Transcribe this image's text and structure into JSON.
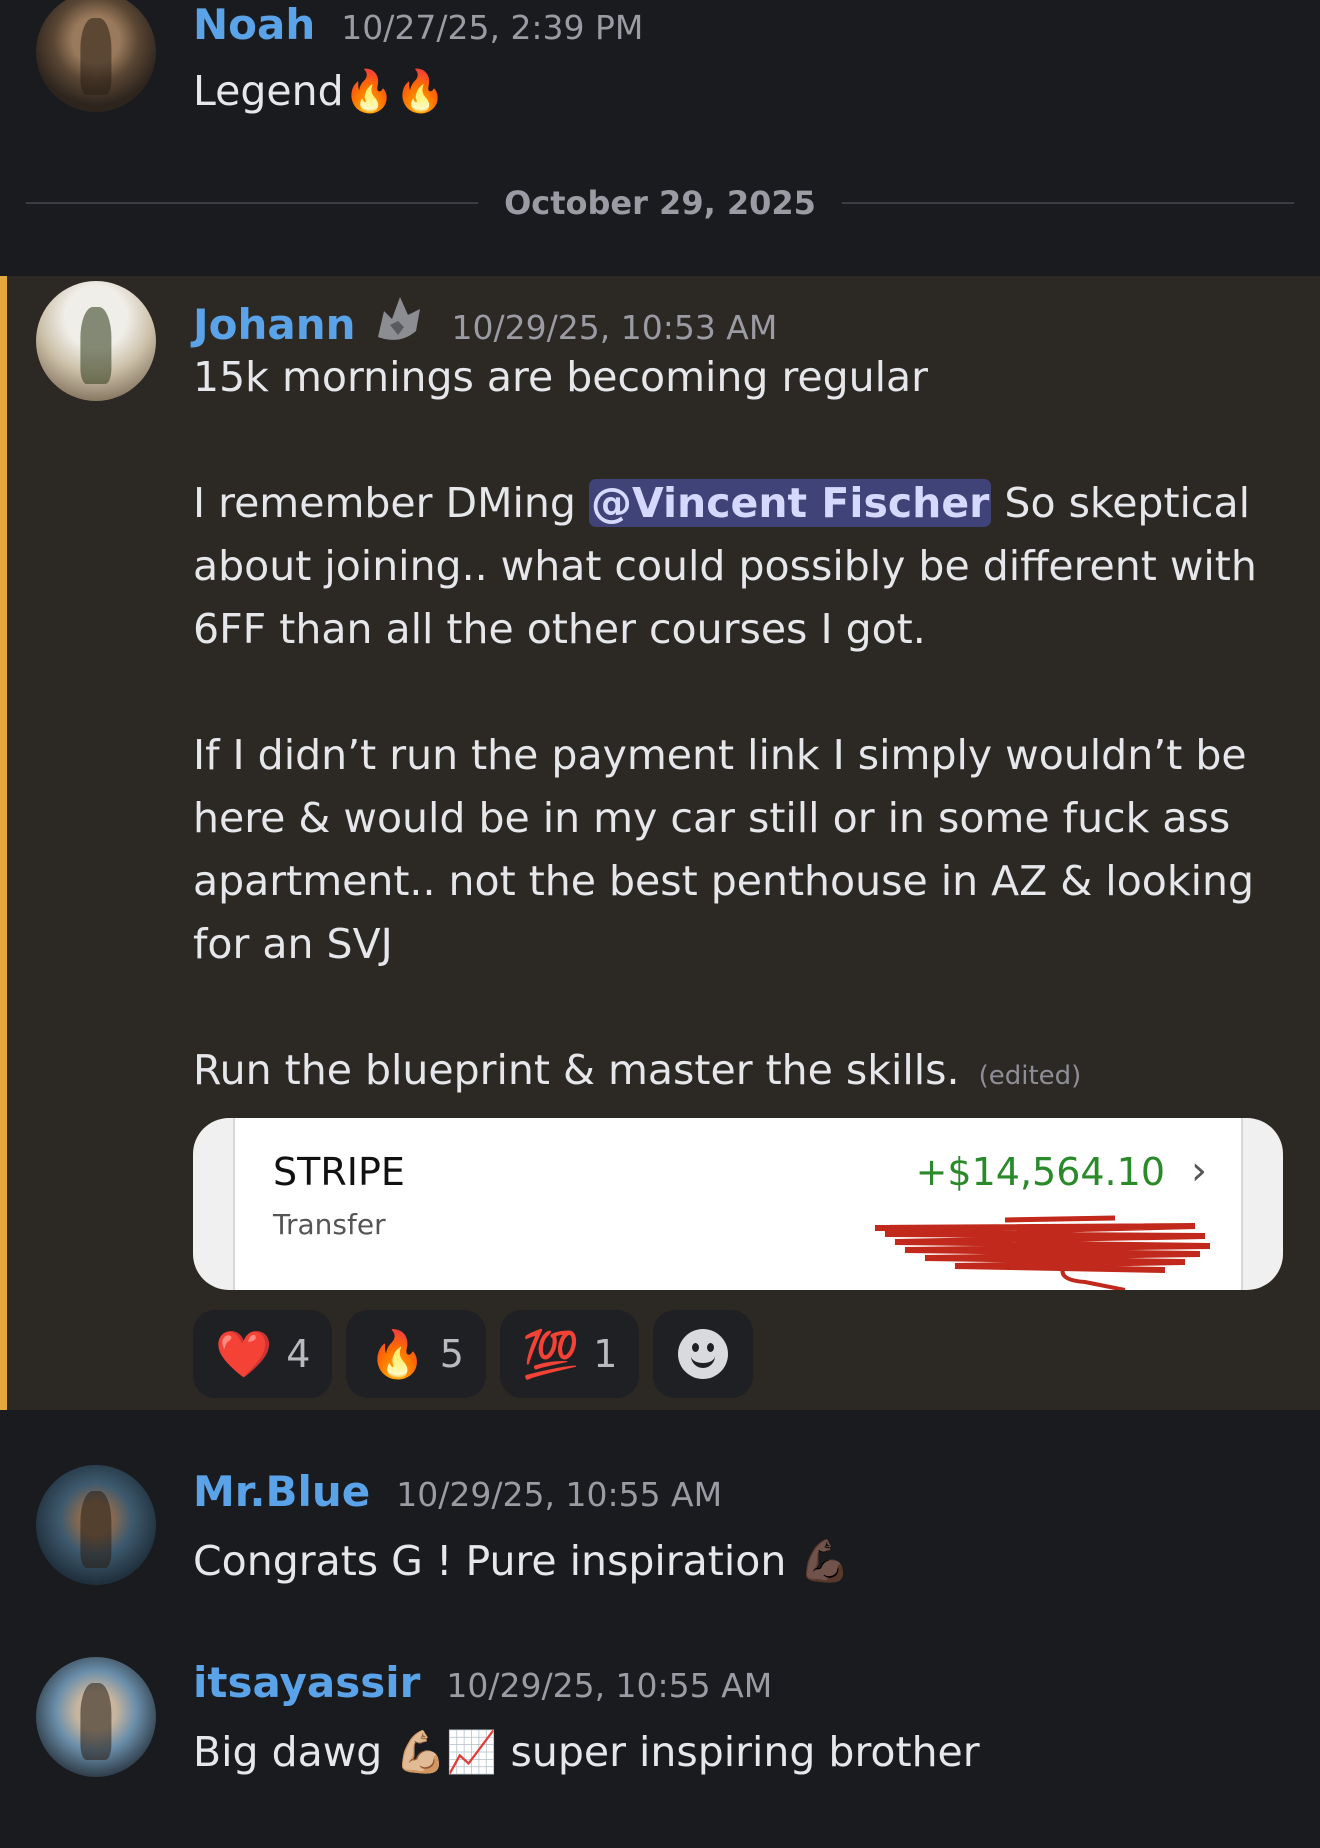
{
  "messages": {
    "noah": {
      "username": "Noah",
      "timestamp": "10/27/25, 2:39 PM",
      "text": "Legend",
      "emojis": "🔥🔥"
    },
    "divider": {
      "date": "October 29, 2025"
    },
    "johann": {
      "username": "Johann",
      "badge_icon": "wolf-icon",
      "timestamp": "10/29/25, 10:53 AM",
      "line1": "15k mornings are becoming regular",
      "para2_before": "I remember DMing",
      "mention": "@Vincent Fischer",
      "para2_after": "So skeptical",
      "para2_l2": "about joining.. what could possibly be different with",
      "para2_l3": "6FF than all the other courses I got.",
      "para3_l1": "If I didn’t run the payment link I simply wouldn’t be",
      "para3_l2": "here & would be in my car still or in some fuck ass",
      "para3_l3": "apartment.. not the best penthouse in AZ & looking",
      "para3_l4": "for an SVJ",
      "para4": "Run the blueprint & master the skills.",
      "edited": "(edited)",
      "attachment": {
        "title": "STRIPE",
        "subtitle": "Transfer",
        "amount": "+$14,564.10",
        "chevron": "›"
      },
      "reactions": [
        {
          "emoji": "❤️",
          "count": "4"
        },
        {
          "emoji": "🔥",
          "count": "5"
        },
        {
          "emoji": "💯",
          "count": "1"
        }
      ],
      "highlight_color": "#e3a93b"
    },
    "mrblue": {
      "username": "Mr.Blue",
      "timestamp": "10/29/25, 10:55 AM",
      "text": "Congrats G ! Pure inspiration",
      "emoji": "💪🏿"
    },
    "yassir": {
      "username": "itsayassir",
      "timestamp": "10/29/25, 10:55 AM",
      "text_before": "Big dawg",
      "emoji": "💪🏼📈",
      "text_after": "super inspiring brother"
    }
  }
}
